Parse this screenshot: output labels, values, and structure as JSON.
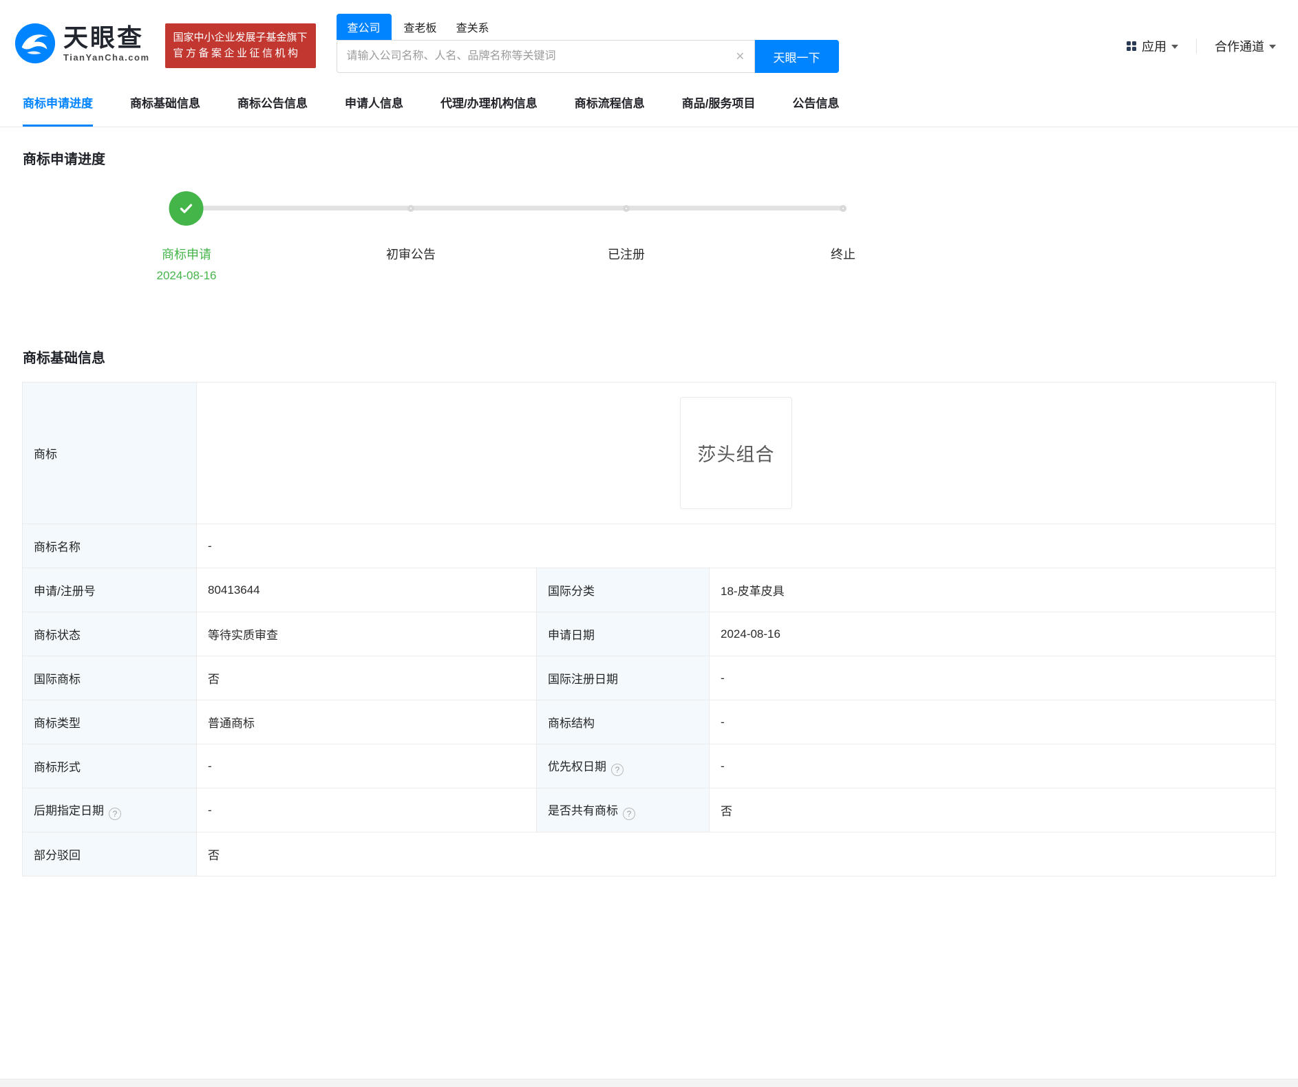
{
  "header": {
    "logo": {
      "name": "天眼查",
      "domain": "TianYanCha.com"
    },
    "badge": {
      "line1": "国家中小企业发展子基金旗下",
      "line2": "官方备案企业征信机构"
    },
    "search": {
      "tabs": [
        {
          "label": "查公司",
          "active": true
        },
        {
          "label": "查老板",
          "active": false
        },
        {
          "label": "查关系",
          "active": false
        }
      ],
      "placeholder": "请输入公司名称、人名、品牌名称等关键词",
      "clear_icon": "×",
      "button": "天眼一下"
    },
    "right": {
      "apps": "应用",
      "cooperation": "合作通道"
    }
  },
  "nav": {
    "tabs": [
      {
        "label": "商标申请进度",
        "active": true
      },
      {
        "label": "商标基础信息",
        "active": false
      },
      {
        "label": "商标公告信息",
        "active": false
      },
      {
        "label": "申请人信息",
        "active": false
      },
      {
        "label": "代理/办理机构信息",
        "active": false
      },
      {
        "label": "商标流程信息",
        "active": false
      },
      {
        "label": "商品/服务项目",
        "active": false
      },
      {
        "label": "公告信息",
        "active": false
      }
    ]
  },
  "progress": {
    "title": "商标申请进度",
    "steps": [
      {
        "label": "商标申请",
        "date": "2024-08-16",
        "state": "done"
      },
      {
        "label": "初审公告",
        "state": "pending"
      },
      {
        "label": "已注册",
        "state": "pending"
      },
      {
        "label": "终止",
        "state": "pending"
      }
    ]
  },
  "basic": {
    "title": "商标基础信息",
    "mark": {
      "label": "商标",
      "image_text": "莎头组合"
    },
    "name_row": {
      "label": "商标名称",
      "value": "-"
    },
    "rows": [
      {
        "l1": "申请/注册号",
        "v1": "80413644",
        "l2": "国际分类",
        "v2": "18-皮革皮具"
      },
      {
        "l1": "商标状态",
        "v1": "等待实质审查",
        "l2": "申请日期",
        "v2": "2024-08-16"
      },
      {
        "l1": "国际商标",
        "v1": "否",
        "l2": "国际注册日期",
        "v2": "-"
      },
      {
        "l1": "商标类型",
        "v1": "普通商标",
        "l2": "商标结构",
        "v2": "-"
      },
      {
        "l1": "商标形式",
        "v1": "-",
        "l2": "优先权日期",
        "v2": "-"
      },
      {
        "l1": "后期指定日期",
        "v1": "-",
        "l2": "是否共有商标",
        "v2": "否"
      }
    ],
    "last_row": {
      "label": "部分驳回",
      "value": "否"
    },
    "help_mark": "?"
  },
  "colors": {
    "brand_blue": "#0084ff",
    "badge_red": "#c23831",
    "success_green": "#44b549",
    "label_bg": "#f3f9fd",
    "table_border": "#ebebeb"
  }
}
